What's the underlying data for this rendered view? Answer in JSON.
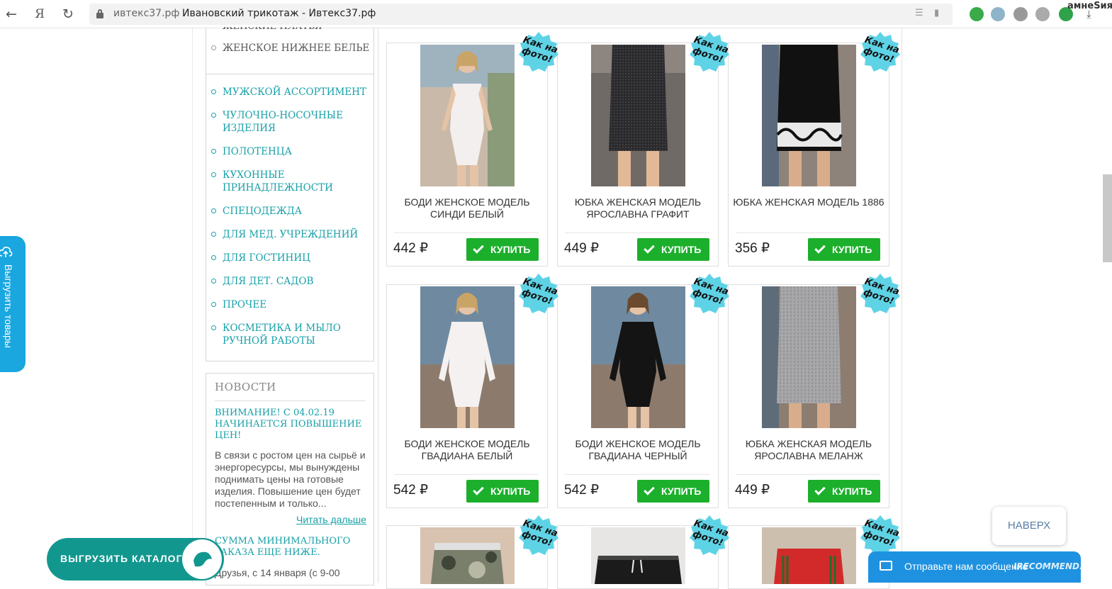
{
  "browser": {
    "domain": "ивтекс37.рф",
    "title": "Ивановский трикотаж - Ивтекс37.рф",
    "back": "←",
    "yandex": "Я",
    "reload": "↻",
    "profile": "амнеSия",
    "download": "⤓"
  },
  "sidebar": {
    "cut_item": "ЖЕНСКИЕ ПЛАТЬЯ",
    "sub_item": "ЖЕНСКОЕ НИЖНЕЕ БЕЛЬЕ",
    "items": [
      "МУЖСКОЙ АССОРТИМЕНТ",
      "ЧУЛОЧНО-НОСОЧНЫЕ ИЗДЕЛИЯ",
      "ПОЛОТЕНЦА",
      "КУХОННЫЕ ПРИНАДЛЕЖНОСТИ",
      "СПЕЦОДЕЖДА",
      "ДЛЯ МЕД. УЧРЕЖДЕНИЙ",
      "ДЛЯ ГОСТИНИЦ",
      "ДЛЯ ДЕТ. САДОВ",
      "ПРОЧЕЕ",
      "КОСМЕТИКА И МЫЛО РУЧНОЙ РАБОТЫ"
    ]
  },
  "news": {
    "title": "НОВОСТИ",
    "headline": "ВНИМАНИЕ! С 04.02.19 НАЧИНАЕТСЯ ПОВЫШЕНИЕ ЦЕН!",
    "text": "В связи с ростом цен на сырьё и энергоресурсы, мы вынуждены поднимать цены на готовые изделия. Повышение цен будет постепенным и только...",
    "more": "Читать дальше",
    "headline2": "СУММА МИНИМАЛЬНОГО ЗАКАЗА ЕЩЕ НИЖЕ.",
    "text2": "Друзья, с 14 января  (с 9-00"
  },
  "badge": {
    "line1": "Как на",
    "line2": "фото!"
  },
  "buy_label": "КУПИТЬ",
  "products": [
    {
      "name": "БОДИ ЖЕНСКОЕ МОДЕЛЬ СИНДИ БЕЛЫЙ",
      "price": "442 ₽"
    },
    {
      "name": "ЮБКА ЖЕНСКАЯ МОДЕЛЬ ЯРОСЛАВНА ГРАФИТ",
      "price": "449 ₽"
    },
    {
      "name": "ЮБКА ЖЕНСКАЯ МОДЕЛЬ 1886",
      "price": "356 ₽"
    },
    {
      "name": "БОДИ ЖЕНСКОЕ МОДЕЛЬ ГВАДИАНА БЕЛЫЙ",
      "price": "542 ₽"
    },
    {
      "name": "БОДИ ЖЕНСКОЕ МОДЕЛЬ ГВАДИАНА ЧЕРНЫЙ",
      "price": "542 ₽"
    },
    {
      "name": "ЮБКА ЖЕНСКАЯ МОДЕЛЬ ЯРОСЛАВНА МЕЛАНЖ",
      "price": "449 ₽"
    }
  ],
  "widgets": {
    "side_tab": "Выгрузить товары",
    "catalog": "ВЫГРУЗИТЬ КАТАЛОГ",
    "up": "НАВЕРХ",
    "message": "Отправьте нам сообщение",
    "watermark": "IRECOMMEND.RU"
  },
  "colors": {
    "accent": "#17a0a8",
    "buy": "#1caf2c",
    "badge": "#5fd3e6",
    "tab": "#1aa6df",
    "catalog": "#12978f"
  }
}
